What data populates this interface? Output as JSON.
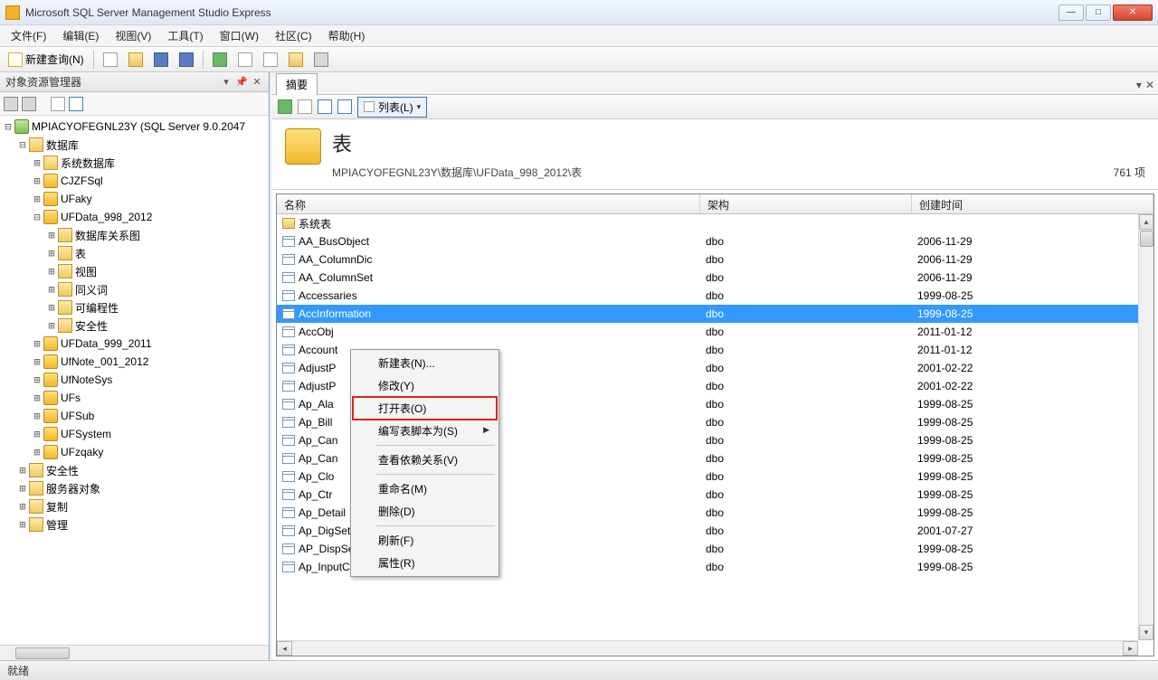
{
  "window": {
    "title": "Microsoft SQL Server Management Studio Express"
  },
  "menubar": [
    "文件(F)",
    "编辑(E)",
    "视图(V)",
    "工具(T)",
    "窗口(W)",
    "社区(C)",
    "帮助(H)"
  ],
  "toolbar": {
    "new_query": "新建查询(N)"
  },
  "oe": {
    "title": "对象资源管理器",
    "server": "MPIACYOFEGNL23Y (SQL Server 9.0.2047",
    "nodes": {
      "databases": "数据库",
      "sysdb": "系统数据库",
      "cjzf": "CJZFSql",
      "ufaky": "UFaky",
      "ufdata998": "UFData_998_2012",
      "diagrams": "数据库关系图",
      "tables": "表",
      "views": "视图",
      "synonyms": "同义词",
      "programmability": "可编程性",
      "security_db": "安全性",
      "ufdata999": "UFData_999_2011",
      "ufnote001": "UfNote_001_2012",
      "ufnotesys": "UfNoteSys",
      "ufs": "UFs",
      "ufsub": "UFSub",
      "ufsystem": "UFSystem",
      "ufzqaky": "UFzqaky",
      "security": "安全性",
      "server_objects": "服务器对象",
      "replication": "复制",
      "management": "管理"
    }
  },
  "summary": {
    "tab": "摘要",
    "list_label": "列表(L)",
    "heading": "表",
    "path": "MPIACYOFEGNL23Y\\数据库\\UFData_998_2012\\表",
    "count": "761 项",
    "columns": {
      "name": "名称",
      "schema": "架构",
      "created": "创建时间"
    },
    "sys_tables": "系统表",
    "rows": [
      {
        "name": "AA_BusObject",
        "schema": "dbo",
        "created": "2006-11-29"
      },
      {
        "name": "AA_ColumnDic",
        "schema": "dbo",
        "created": "2006-11-29"
      },
      {
        "name": "AA_ColumnSet",
        "schema": "dbo",
        "created": "2006-11-29"
      },
      {
        "name": "Accessaries",
        "schema": "dbo",
        "created": "1999-08-25"
      },
      {
        "name": "AccInformation",
        "schema": "dbo",
        "created": "1999-08-25",
        "selected": true
      },
      {
        "name": "AccObj",
        "schema": "dbo",
        "created": "2011-01-12"
      },
      {
        "name": "Account",
        "schema": "dbo",
        "created": "2011-01-12"
      },
      {
        "name": "AdjustP",
        "schema": "dbo",
        "created": "2001-02-22"
      },
      {
        "name": "AdjustP",
        "schema": "dbo",
        "created": "2001-02-22"
      },
      {
        "name": "Ap_Ala",
        "schema": "dbo",
        "created": "1999-08-25"
      },
      {
        "name": "Ap_Bill",
        "schema": "dbo",
        "created": "1999-08-25"
      },
      {
        "name": "Ap_Can",
        "schema": "dbo",
        "created": "1999-08-25"
      },
      {
        "name": "Ap_Can",
        "schema": "dbo",
        "created": "1999-08-25"
      },
      {
        "name": "Ap_Clo",
        "schema": "dbo",
        "created": "1999-08-25"
      },
      {
        "name": "Ap_Ctr",
        "schema": "dbo",
        "created": "1999-08-25"
      },
      {
        "name": "Ap_Detail",
        "schema": "dbo",
        "created": "1999-08-25"
      },
      {
        "name": "Ap_DigSet",
        "schema": "dbo",
        "created": "2001-07-27"
      },
      {
        "name": "AP_DispSet",
        "schema": "dbo",
        "created": "1999-08-25"
      },
      {
        "name": "Ap_InputCode",
        "schema": "dbo",
        "created": "1999-08-25"
      }
    ]
  },
  "context_menu": {
    "new_table": "新建表(N)...",
    "modify": "修改(Y)",
    "open_table": "打开表(O)",
    "script_as": "编写表脚本为(S)",
    "view_deps": "查看依赖关系(V)",
    "rename": "重命名(M)",
    "delete": "删除(D)",
    "refresh": "刷新(F)",
    "properties": "属性(R)"
  },
  "statusbar": {
    "ready": "就绪"
  }
}
